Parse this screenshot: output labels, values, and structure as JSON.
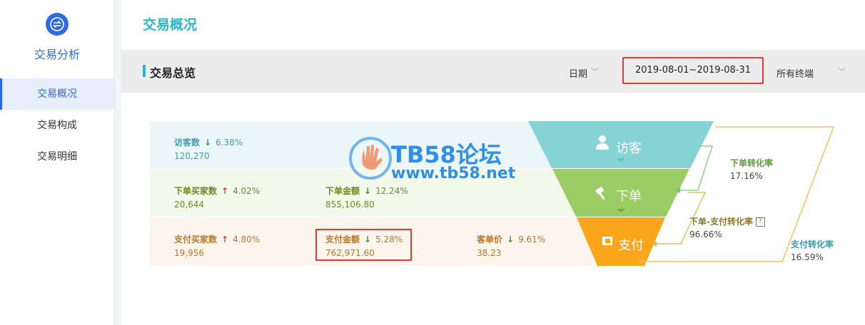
{
  "sidebar": {
    "app_icon": "swap-icon",
    "app_title": "交易分析",
    "items": [
      {
        "label": "交易概况",
        "active": true
      },
      {
        "label": "交易构成",
        "active": false
      },
      {
        "label": "交易明细",
        "active": false
      }
    ]
  },
  "header": {
    "title": "交易概况"
  },
  "overview": {
    "title": "交易总览",
    "date_label": "日期",
    "date_range": "2019-08-01~2019-08-31",
    "terminal": "所有终端"
  },
  "metrics": {
    "visitors": {
      "label": "访客数",
      "change": "6.38%",
      "direction": "down",
      "value": "120,270"
    },
    "order_buyers": {
      "label": "下单买家数",
      "change": "4.02%",
      "direction": "up",
      "value": "20,644"
    },
    "order_amount": {
      "label": "下单金额",
      "change": "12.24%",
      "direction": "down",
      "value": "855,106.80"
    },
    "pay_buyers": {
      "label": "支付买家数",
      "change": "4.80%",
      "direction": "up",
      "value": "19,956"
    },
    "pay_amount": {
      "label": "支付金额",
      "change": "5.28%",
      "direction": "down",
      "value": "762,971.60"
    },
    "avg_price": {
      "label": "客单价",
      "change": "9.61%",
      "direction": "down",
      "value": "38.23"
    }
  },
  "funnel": {
    "stages": [
      {
        "label": "访客",
        "icon": "user-icon",
        "color": "#86d3d5"
      },
      {
        "label": "下单",
        "icon": "hammer-icon",
        "color": "#9ccc65"
      },
      {
        "label": "支付",
        "icon": "wallet-icon",
        "color": "#fba51a"
      }
    ],
    "rates": [
      {
        "label": "下单转化率",
        "value": "17.16%"
      },
      {
        "label": "下单-支付转化率",
        "value": "96.66%",
        "help_icon": "question-icon"
      },
      {
        "label": "支付转化率",
        "value": "16.59%"
      }
    ]
  },
  "watermark": {
    "title": "TB58论坛",
    "url": "www.tb58.net"
  },
  "colors": {
    "accent": "#2ab7c9",
    "brand": "#2f6be0",
    "highlight": "#e53935"
  }
}
